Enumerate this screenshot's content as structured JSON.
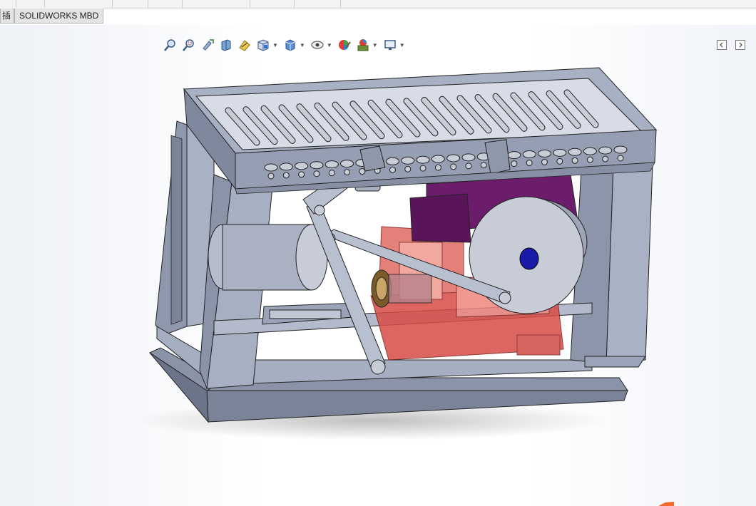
{
  "tabs": [
    {
      "label": "插件"
    },
    {
      "label": "SOLIDWORKS MBD"
    }
  ],
  "toolbar": {
    "items": [
      {
        "name": "zoom-to-fit-icon"
      },
      {
        "name": "zoom-to-area-icon"
      },
      {
        "name": "previous-view-icon"
      },
      {
        "name": "section-view-icon"
      },
      {
        "name": "dynamic-annotation-views-icon"
      },
      {
        "name": "view-orientation-icon"
      },
      {
        "name": "display-style-icon"
      },
      {
        "name": "hide-show-items-icon"
      },
      {
        "name": "edit-appearance-icon"
      },
      {
        "name": "apply-scene-icon"
      },
      {
        "name": "view-settings-icon"
      }
    ],
    "right": [
      {
        "name": "panel-left-icon"
      },
      {
        "name": "panel-right-icon"
      }
    ]
  },
  "colors": {
    "frame": "#9aa3b8",
    "frame_dark": "#5d6478",
    "motor": "#6b1d6b",
    "gearbox": "#d9534f",
    "flywheel": "#c7ccd6",
    "hub": "#1a1aa8"
  }
}
